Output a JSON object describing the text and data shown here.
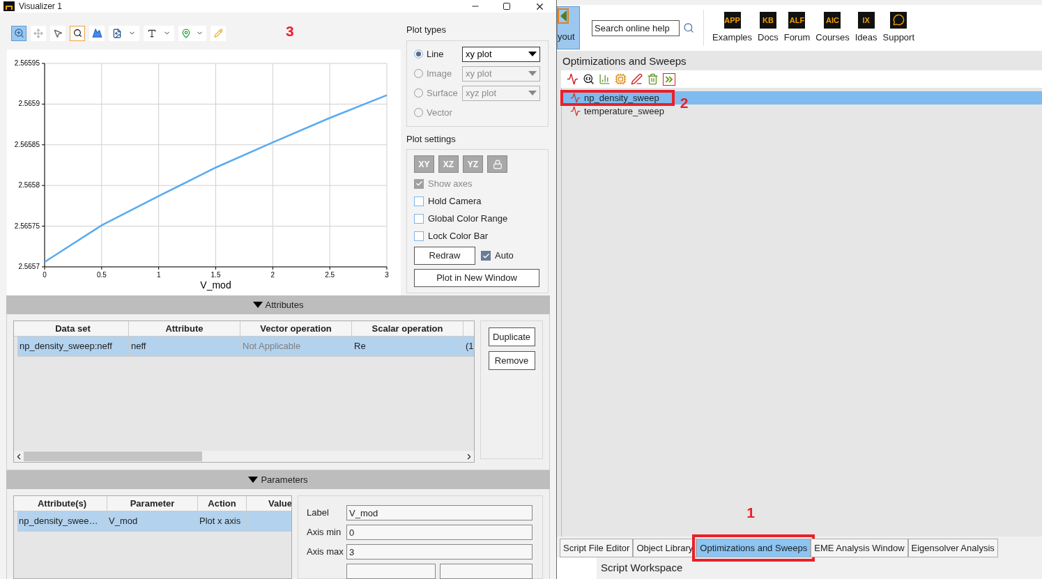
{
  "visualizer": {
    "title": "Visualizer 1",
    "toolbar_annotation": "3",
    "chart": {
      "chart_data": {
        "type": "line",
        "xlabel": "V_mod",
        "x": [
          0,
          0.5,
          1,
          1.5,
          2,
          2.5,
          3
        ],
        "grid": true,
        "series": [
          {
            "color": "#5aaaf0",
            "values": [
              2.565706,
              2.565751,
              2.565787,
              2.565822,
              2.565853,
              2.565883,
              2.565911
            ]
          }
        ],
        "xlim": [
          0,
          3
        ],
        "ylim": [
          2.5657,
          2.56595
        ],
        "xticks": [
          0,
          0.5,
          1,
          1.5,
          2,
          2.5,
          3
        ],
        "yticks": [
          2.5657,
          2.56575,
          2.5658,
          2.56585,
          2.5659,
          2.56595
        ]
      }
    },
    "plot_types": {
      "title": "Plot types",
      "options": [
        {
          "label": "Line",
          "selected": true,
          "disabled": false,
          "dropdown": "xy plot"
        },
        {
          "label": "Image",
          "selected": false,
          "disabled": true,
          "dropdown": "xy plot"
        },
        {
          "label": "Surface",
          "selected": false,
          "disabled": true,
          "dropdown": "xyz plot"
        },
        {
          "label": "Vector",
          "selected": false,
          "disabled": true
        }
      ]
    },
    "plot_settings": {
      "title": "Plot settings",
      "view_buttons": [
        "XY",
        "XZ",
        "YZ"
      ],
      "checkboxes": [
        {
          "label": "Show axes",
          "checked": true,
          "disabled": true
        },
        {
          "label": "Hold Camera",
          "checked": false,
          "disabled": false
        },
        {
          "label": "Global Color Range",
          "checked": false,
          "disabled": false
        },
        {
          "label": "Lock Color Bar",
          "checked": false,
          "disabled": false
        }
      ],
      "redraw": "Redraw",
      "auto": {
        "label": "Auto",
        "checked": true
      },
      "new_window": "Plot in New Window"
    },
    "attributes": {
      "title": "Attributes",
      "columns": [
        "Data set",
        "Attribute",
        "Vector operation",
        "Scalar operation"
      ],
      "rows": [
        {
          "selected": true,
          "cells": [
            {
              "text": "np_density_sweep:neff",
              "disabled": false
            },
            {
              "text": "neff",
              "disabled": false
            },
            {
              "text": "Not Applicable",
              "disabled": true
            },
            {
              "text": "Re",
              "disabled": false
            },
            {
              "text": "(1",
              "disabled": false
            }
          ]
        }
      ],
      "buttons": [
        "Duplicate",
        "Remove"
      ]
    },
    "parameters": {
      "title": "Parameters",
      "columns": [
        "Attribute(s)",
        "Parameter",
        "Action",
        "Value"
      ],
      "rows": [
        {
          "selected": true,
          "cells": [
            "np_density_swee…",
            "V_mod",
            "Plot x axis"
          ]
        }
      ],
      "fields": [
        {
          "label": "Label",
          "value": "V_mod"
        },
        {
          "label": "Axis min",
          "value": "0"
        },
        {
          "label": "Axis max",
          "value": "3"
        }
      ]
    }
  },
  "main": {
    "layout_button": "yout",
    "search": {
      "value": "Search online help"
    },
    "links": [
      {
        "badge": "APP",
        "label": "Examples",
        "kind": "badge"
      },
      {
        "badge": "KB",
        "label": "Docs",
        "kind": "badge"
      },
      {
        "badge": "ALF",
        "label": "Forum",
        "kind": "badge"
      },
      {
        "badge": "AIC",
        "label": "Courses",
        "kind": "badge"
      },
      {
        "badge": "IX",
        "label": "Ideas",
        "kind": "badge"
      },
      {
        "label": "Support",
        "kind": "chat"
      }
    ],
    "sweeps": {
      "title": "Optimizations and Sweeps",
      "items": [
        {
          "label": "np_density_sweep",
          "selected": true,
          "annotation": "2"
        },
        {
          "label": "temperature_sweep",
          "selected": false
        }
      ]
    },
    "tabs": [
      {
        "label": "Script File Editor",
        "selected": false
      },
      {
        "label": "Object Library",
        "selected": false
      },
      {
        "label": "Optimizations and Sweeps",
        "selected": true,
        "annotation": "1"
      },
      {
        "label": "EME Analysis Window",
        "selected": false
      },
      {
        "label": "Eigensolver Analysis",
        "selected": false
      }
    ],
    "workspace": {
      "title": "Script Workspace"
    }
  }
}
